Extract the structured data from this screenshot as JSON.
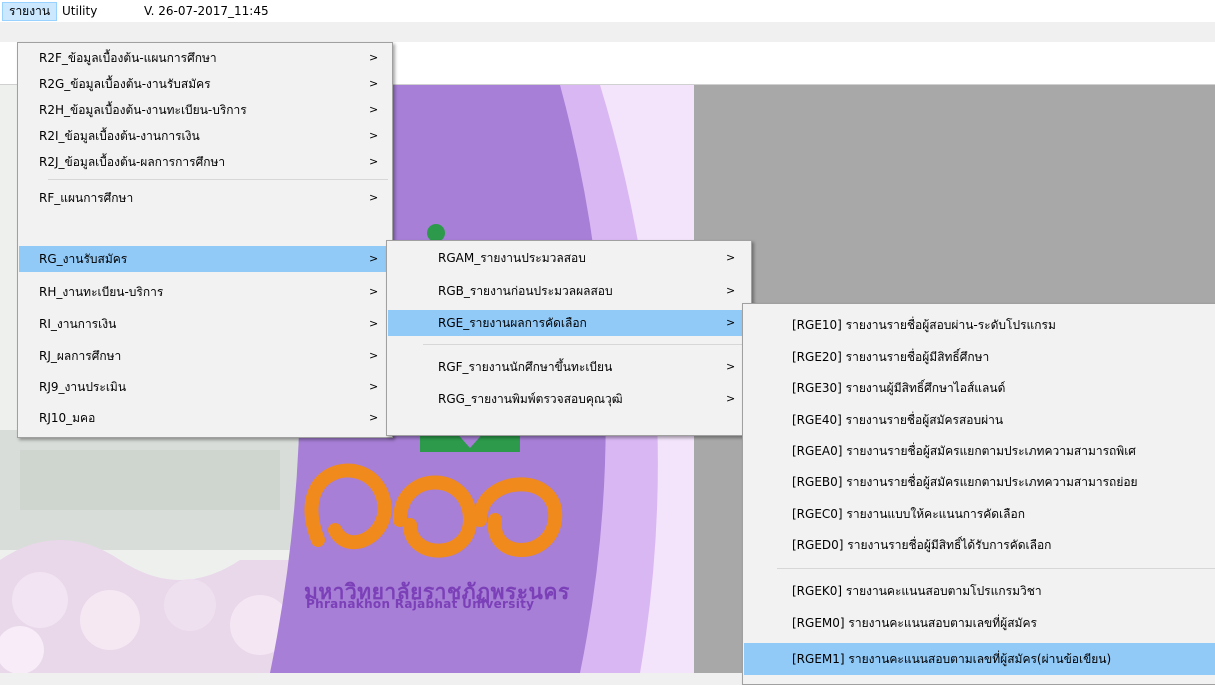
{
  "menubar": {
    "report": "รายงาน",
    "utility": "Utility",
    "version": "V. 26-07-2017_11:45"
  },
  "logo": {
    "thai_name": "มหาวิทยาลัยราชภัฏพระนคร",
    "english_name": "Phranakhon Rajabhat University"
  },
  "menu_main": {
    "items": [
      {
        "label": "R2F_ข้อมูลเบื้องต้น-แผนการศึกษา",
        "arrow": ">"
      },
      {
        "label": "R2G_ข้อมูลเบื้องต้น-งานรับสมัคร",
        "arrow": ">"
      },
      {
        "label": "R2H_ข้อมูลเบื้องต้น-งานทะเบียน-บริการ",
        "arrow": ">"
      },
      {
        "label": "R2I_ข้อมูลเบื้องต้น-งานการเงิน",
        "arrow": ">"
      },
      {
        "label": "R2J_ข้อมูลเบื้องต้น-ผลการการศึกษา",
        "arrow": ">"
      },
      {
        "label": "RF_แผนการศึกษา",
        "arrow": ">"
      },
      {
        "label": "RG_งานรับสมัคร",
        "arrow": ">"
      },
      {
        "label": "RH_งานทะเบียน-บริการ",
        "arrow": ">"
      },
      {
        "label": "RI_งานการเงิน",
        "arrow": ">"
      },
      {
        "label": "RJ_ผลการศึกษา",
        "arrow": ">"
      },
      {
        "label": "RJ9_งานประเมิน",
        "arrow": ">"
      },
      {
        "label": "RJ10_มคอ",
        "arrow": ">"
      }
    ]
  },
  "menu_rg": {
    "items": [
      {
        "label": "RGAM_รายงานประมวลสอบ",
        "arrow": ">"
      },
      {
        "label": "RGB_รายงานก่อนประมวลผลสอบ",
        "arrow": ">"
      },
      {
        "label": "RGE_รายงานผลการคัดเลือก",
        "arrow": ">"
      },
      {
        "label": "RGF_รายงานนักศึกษาขึ้นทะเบียน",
        "arrow": ">"
      },
      {
        "label": "RGG_รายงานพิมพ์ตรวจสอบคุณวุฒิ",
        "arrow": ">"
      }
    ]
  },
  "menu_rge": {
    "items": [
      {
        "label": "[RGE10] รายงานรายชื่อผู้สอบผ่าน-ระดับโปรแกรม"
      },
      {
        "label": "[RGE20] รายงานรายชื่อผู้มีสิทธิ์ศึกษา"
      },
      {
        "label": "[RGE30] รายงานผู้มีสิทธิ์ศึกษาไอส์แลนด์"
      },
      {
        "label": "[RGE40] รายงานรายชื่อผู้สมัครสอบผ่าน"
      },
      {
        "label": "[RGEA0] รายงานรายชื่อผู้สมัครแยกตามประเภทความสามารถพิเศ"
      },
      {
        "label": "[RGEB0] รายงานรายชื่อผู้สมัครแยกตามประเภทความสามารถย่อย"
      },
      {
        "label": "[RGEC0] รายงานแบบให้คะแนนการคัดเลือก"
      },
      {
        "label": "[RGED0] รายงานรายชื่อผู้มีสิทธิ์ได้รับการคัดเลือก"
      },
      {
        "label": "[RGEK0] รายงานคะแนนสอบตามโปรแกรมวิชา"
      },
      {
        "label": "[RGEM0] รายงานคะแนนสอบตามเลขที่ผู้สมัคร"
      },
      {
        "label": "[RGEM1] รายงานคะแนนสอบตามเลขที่ผู้สมัคร(ผ่านข้อเขียน)"
      }
    ]
  },
  "colors": {
    "highlight": "#91c9f7",
    "menu_bg": "#f2f2f2",
    "purple": "#a77fd6",
    "green": "#2c9a4a",
    "orange": "#f08a1c"
  }
}
